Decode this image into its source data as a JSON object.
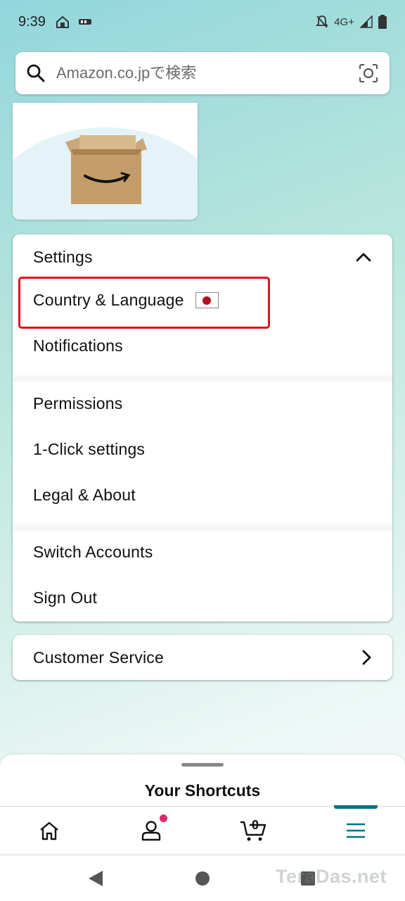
{
  "status_bar": {
    "time": "9:39",
    "network": "4G+"
  },
  "search": {
    "placeholder": "Amazon.co.jpで検索"
  },
  "settings": {
    "header": "Settings",
    "items": [
      {
        "label": "Country & Language",
        "highlighted": true
      },
      {
        "label": "Notifications"
      },
      {
        "label": "Permissions"
      },
      {
        "label": "1-Click settings"
      },
      {
        "label": "Legal & About"
      },
      {
        "label": "Switch Accounts"
      },
      {
        "label": "Sign Out"
      }
    ]
  },
  "customer_service": {
    "label": "Customer Service"
  },
  "shortcuts": {
    "title": "Your Shortcuts"
  },
  "bottom_nav": {
    "items": [
      "home-icon",
      "account-icon",
      "cart-icon",
      "menu-icon"
    ],
    "cart_count": "0",
    "active": "menu"
  },
  "watermark": "TeraDas.net",
  "colors": {
    "accent": "#007185",
    "highlight": "#e0141e",
    "badge": "#e02a6c"
  }
}
